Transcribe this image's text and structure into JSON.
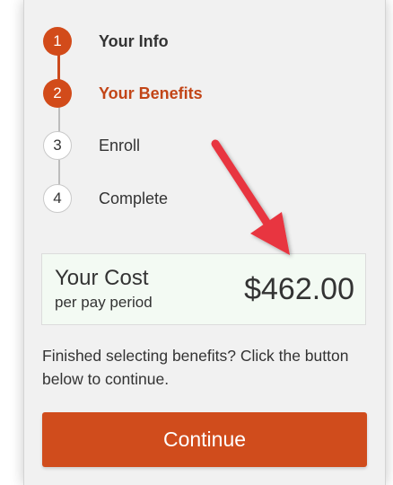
{
  "steps": [
    {
      "number": "1",
      "label": "Your Info",
      "state": "done"
    },
    {
      "number": "2",
      "label": "Your Benefits",
      "state": "current"
    },
    {
      "number": "3",
      "label": "Enroll",
      "state": "todo"
    },
    {
      "number": "4",
      "label": "Complete",
      "state": "todo"
    }
  ],
  "cost": {
    "title": "Your Cost",
    "subtitle": "per pay period",
    "amount": "$462.00"
  },
  "finish_text": "Finished selecting benefits? Click the button below to continue.",
  "continue_label": "Continue",
  "colors": {
    "accent": "#d04c1c",
    "arrow": "#e8343f",
    "cost_box_bg": "#f3faf3",
    "panel_bg": "#f1f1f1"
  }
}
